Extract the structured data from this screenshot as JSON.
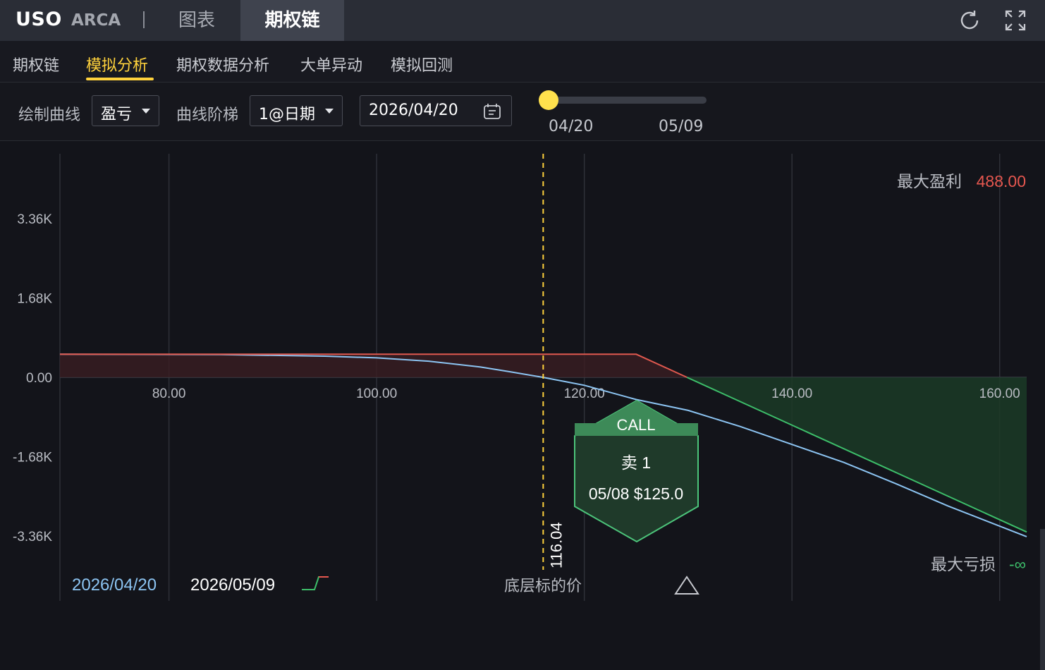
{
  "header": {
    "ticker": "USO",
    "exchange": "ARCA",
    "tabs": [
      {
        "label": "图表",
        "active": false
      },
      {
        "label": "期权链",
        "active": true
      }
    ],
    "icons": [
      "refresh-icon",
      "expand-icon"
    ]
  },
  "subnav": {
    "tabs": [
      {
        "label": "期权链",
        "active": false
      },
      {
        "label": "模拟分析",
        "active": true
      },
      {
        "label": "期权数据分析",
        "active": false
      },
      {
        "label": "大单异动",
        "active": false
      },
      {
        "label": "模拟回测",
        "active": false
      }
    ]
  },
  "controls": {
    "curve_label": "绘制曲线",
    "curve_value": "盈亏",
    "ladder_label": "曲线阶梯",
    "ladder_value": "1@日期",
    "date_value": "2026/04/20",
    "slider": {
      "start_label": "04/20",
      "end_label": "05/09",
      "position": 0
    }
  },
  "colors": {
    "accent": "#ffd23c",
    "profit": "#e5574f",
    "loss": "#3dbe6a",
    "current_curve": "#8cc4f2",
    "expiry_curve": "#e0594f"
  },
  "chart": {
    "max_profit_label": "最大盈利",
    "max_profit_value": "488.00",
    "max_loss_label": "最大亏损",
    "max_loss_value": "-∞",
    "underlying_label": "底层标的价",
    "underlying_price": "116.04",
    "legend": [
      {
        "label": "2026/04/20",
        "color": "#8cc4f2"
      },
      {
        "label": "2026/05/09",
        "color": "#ffffff"
      }
    ],
    "leg": {
      "type": "CALL",
      "action": "卖 1",
      "detail": "05/08 $125.0"
    }
  },
  "chart_data": {
    "type": "line",
    "x_ticks": [
      "80.00",
      "100.00",
      "120.00",
      "140.00",
      "160.00"
    ],
    "y_ticks": [
      "3.36K",
      "1.68K",
      "0.00",
      "-1.68K",
      "-3.36K"
    ],
    "xlim": [
      69.5,
      162.6
    ],
    "ylim": [
      -4520,
      4520
    ],
    "series": [
      {
        "name": "2026/05/09",
        "x": [
          69.5,
          125,
          162.6
        ],
        "y": [
          488,
          488,
          -3272
        ]
      },
      {
        "name": "2026/04/20",
        "x": [
          69.5,
          85,
          95,
          100,
          105,
          110,
          113,
          116,
          118,
          120,
          125,
          130,
          135,
          140,
          145,
          150,
          155,
          162.6
        ],
        "y": [
          488,
          480,
          448,
          411,
          341,
          218,
          112,
          0,
          -84,
          -168,
          -470,
          -700,
          -1040,
          -1420,
          -1800,
          -2250,
          -2720,
          -3370
        ]
      }
    ],
    "underlying_price": 116.04,
    "breakeven": 129.88
  }
}
